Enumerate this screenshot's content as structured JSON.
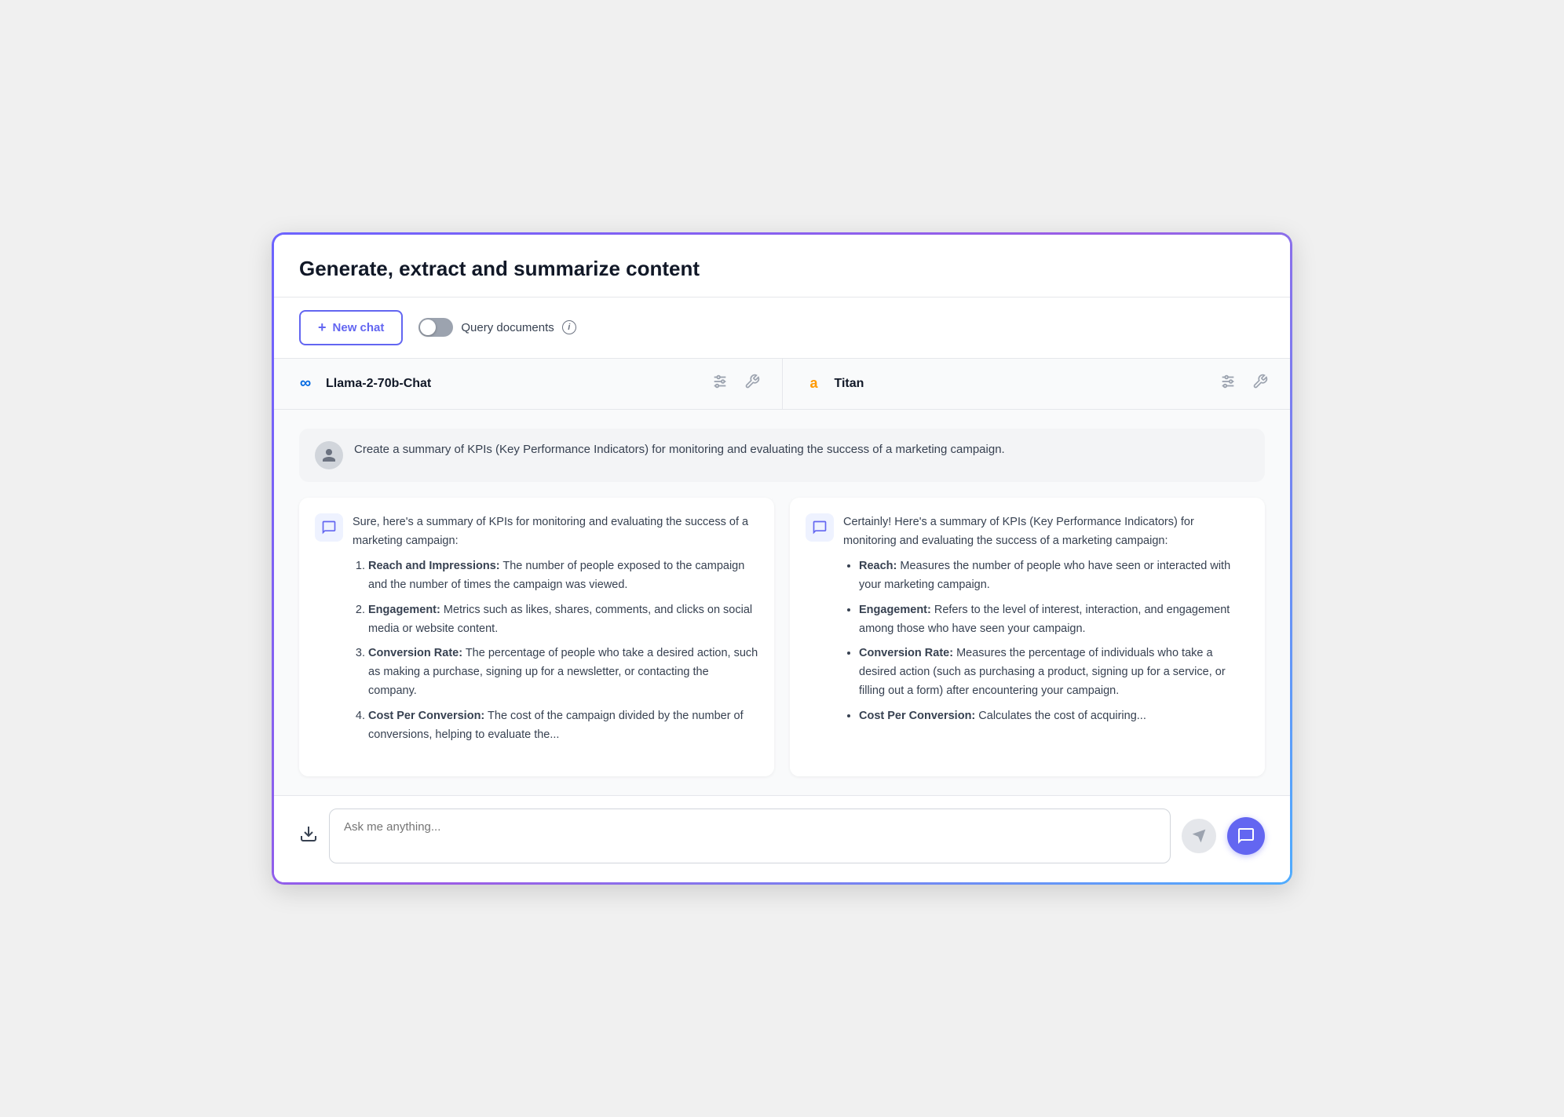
{
  "page": {
    "title": "Generate, extract and summarize content"
  },
  "toolbar": {
    "new_chat_label": "New chat",
    "query_docs_label": "Query documents"
  },
  "models": [
    {
      "id": "llama",
      "logo_type": "meta",
      "name": "Llama-2-70b-Chat"
    },
    {
      "id": "titan",
      "logo_type": "amazon",
      "name": "Titan"
    }
  ],
  "user_message": "Create a summary of KPIs (Key Performance Indicators) for monitoring and evaluating the success of a marketing campaign.",
  "responses": [
    {
      "model_id": "llama",
      "intro": "Sure, here's a summary of KPIs for monitoring and evaluating the success of a marketing campaign:",
      "items": [
        {
          "label": "Reach and Impressions:",
          "text": "The number of people exposed to the campaign and the number of times the campaign was viewed."
        },
        {
          "label": "Engagement:",
          "text": "Metrics such as likes, shares, comments, and clicks on social media or website content."
        },
        {
          "label": "Conversion Rate:",
          "text": "The percentage of people who take a desired action, such as making a purchase, signing up for a newsletter, or contacting the company."
        },
        {
          "label": "Cost Per Conversion:",
          "text": "The cost of the campaign divided by the number of conversions, helping to evaluate the..."
        }
      ],
      "list_type": "ordered"
    },
    {
      "model_id": "titan",
      "intro": "Certainly! Here's a summary of KPIs (Key Performance Indicators) for monitoring and evaluating the success of a marketing campaign:",
      "items": [
        {
          "label": "Reach:",
          "text": "Measures the number of people who have seen or interacted with your marketing campaign."
        },
        {
          "label": "Engagement:",
          "text": "Refers to the level of interest, interaction, and engagement among those who have seen your campaign."
        },
        {
          "label": "Conversion Rate:",
          "text": "Measures the percentage of individuals who take a desired action (such as purchasing a product, signing up for a service, or filling out a form) after encountering your campaign."
        },
        {
          "label": "Cost Per Conversion:",
          "text": "Calculates the cost of acquiring..."
        }
      ],
      "list_type": "unordered"
    }
  ],
  "input": {
    "placeholder": "Ask me anything..."
  }
}
